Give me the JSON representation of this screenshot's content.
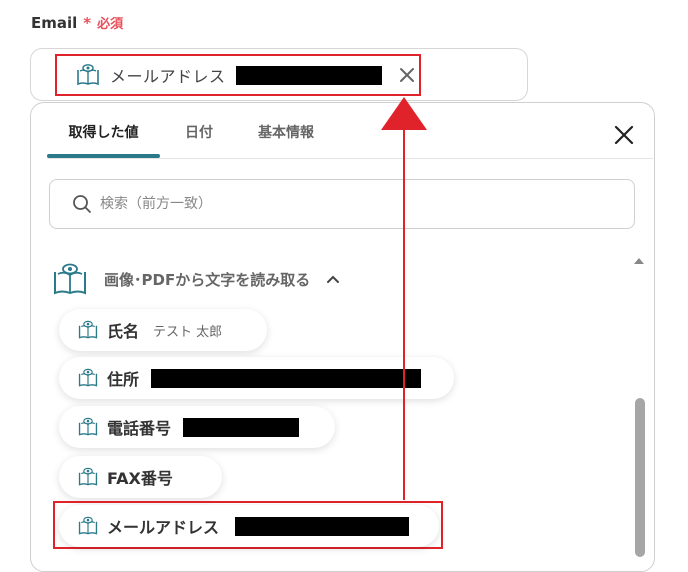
{
  "field": {
    "label": "Email",
    "required_star": "*",
    "required_text": "必須"
  },
  "token": {
    "icon": "book-eye-icon",
    "label": "メールアドレス",
    "value_redacted": true,
    "close_icon": "close-icon"
  },
  "panel": {
    "tabs": [
      {
        "label": "取得した値",
        "active": true
      },
      {
        "label": "日付",
        "active": false
      },
      {
        "label": "基本情報",
        "active": false
      }
    ],
    "close_icon": "close-icon",
    "search": {
      "placeholder": "検索（前方一致）",
      "icon": "search-icon"
    },
    "group": {
      "label": "画像･PDFから文字を読み取る",
      "icon": "book-eye-icon",
      "chevron": "chevron-up-icon"
    },
    "items": [
      {
        "label": "氏名",
        "value": "テスト 太郎"
      },
      {
        "label": "住所",
        "value_redacted": true
      },
      {
        "label": "電話番号",
        "value_redacted": true
      },
      {
        "label": "FAX番号",
        "value": ""
      },
      {
        "label": "メールアドレス",
        "value_redacted": true,
        "highlighted": true
      }
    ]
  },
  "colors": {
    "accent": "#2b7a8a",
    "required": "#e8505b",
    "annotation": "#e0232b",
    "redaction": "#000000"
  }
}
